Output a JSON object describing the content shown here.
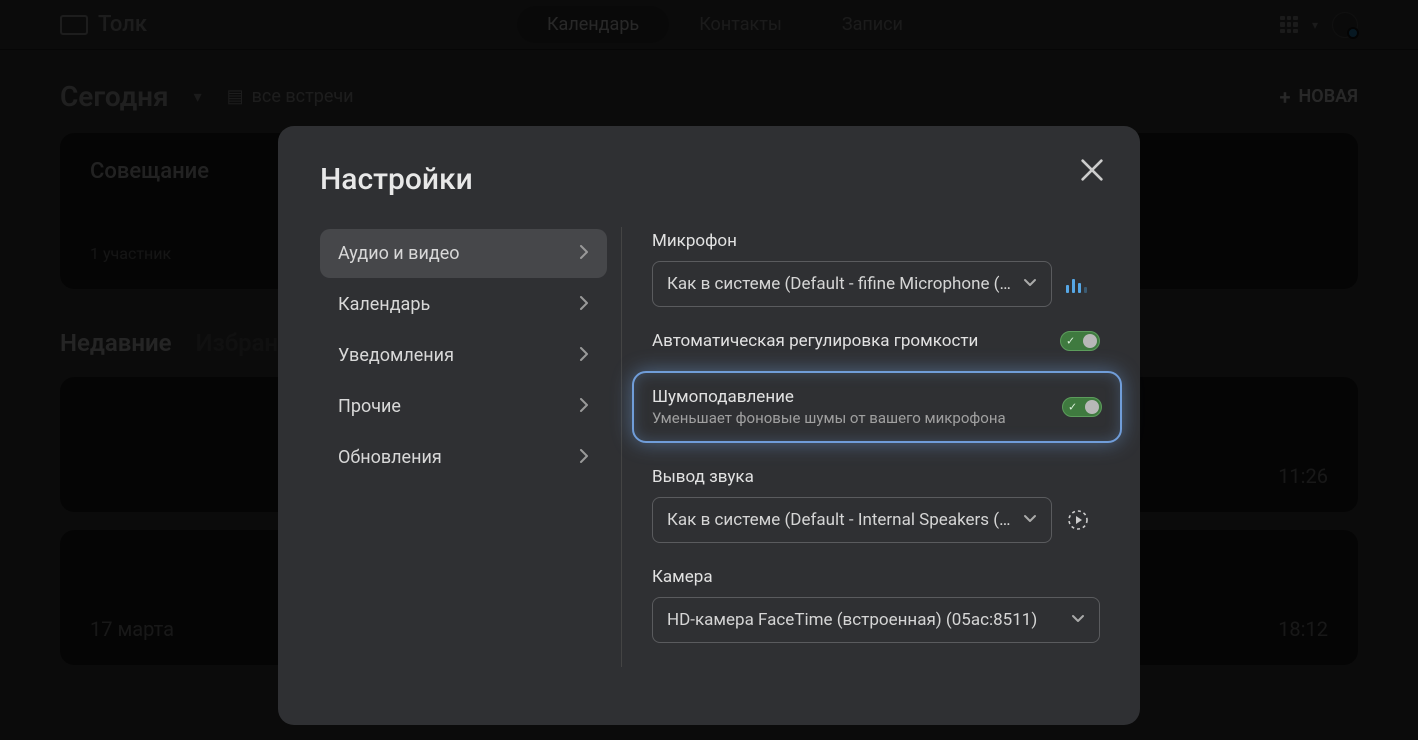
{
  "header": {
    "brand": "Толк",
    "tabs": [
      "Календарь",
      "Контакты",
      "Записи"
    ],
    "active_tab": 0
  },
  "subheader": {
    "title": "Сегодня",
    "all_meetings": "все встречи",
    "new_button": "НОВАЯ"
  },
  "upcoming_card": {
    "title": "Совещание",
    "participants": "1 участник"
  },
  "history_tabs": {
    "recent": "Недавние",
    "favorites": "Избранное"
  },
  "history": [
    {
      "date": "",
      "time": "11:26"
    },
    {
      "date": "17 марта",
      "time": "18:12"
    }
  ],
  "modal": {
    "title": "Настройки",
    "nav": [
      "Аудио и видео",
      "Календарь",
      "Уведомления",
      "Прочие",
      "Обновления"
    ],
    "sections": {
      "mic_label": "Микрофон",
      "mic_value": "Как в системе (Default - fifine Microphone (…",
      "agc_label": "Автоматическая регулировка громкости",
      "noise_title": "Шумоподавление",
      "noise_desc": "Уменьшает фоновые шумы от вашего микрофона",
      "output_label": "Вывод звука",
      "output_value": "Как в системе (Default - Internal Speakers (…",
      "camera_label": "Камера",
      "camera_value": "HD-камера FaceTime (встроенная) (05ac:8511)"
    }
  }
}
